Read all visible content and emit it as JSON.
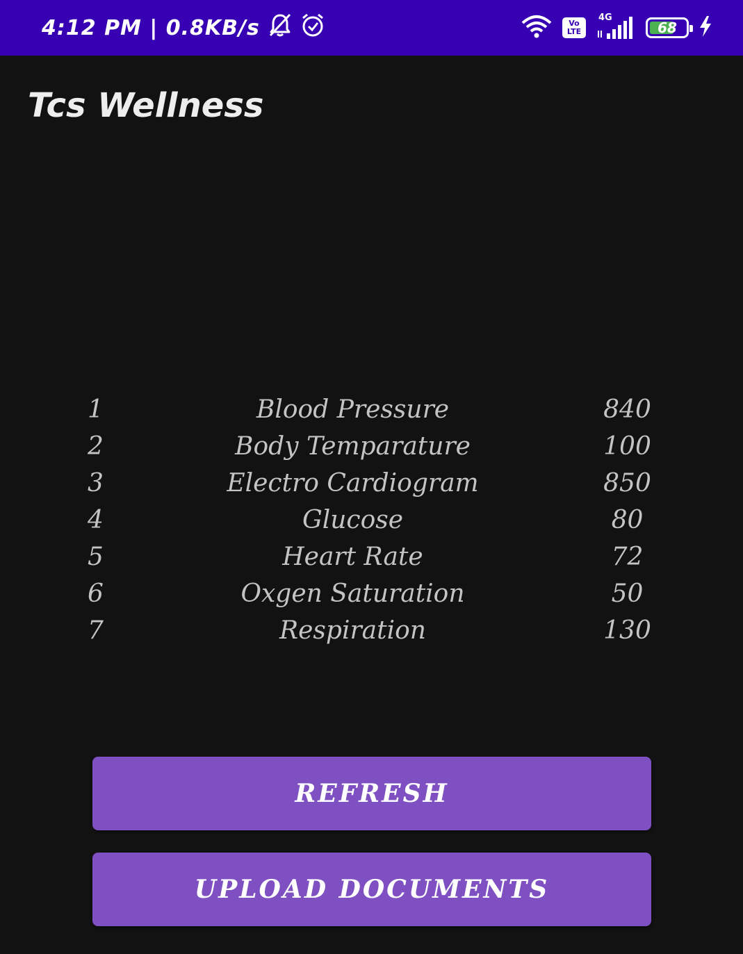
{
  "status_bar": {
    "time_speed": "4:12 PM | 0.8KB/s",
    "network_type": "4G",
    "volte_top": "Vo",
    "volte_bottom": "LTE",
    "battery_level": "68",
    "battery_fraction": 0.68,
    "icons": [
      "bell-off-icon",
      "alarm-icon",
      "wifi-icon",
      "volte-icon",
      "signal-icon",
      "battery-icon",
      "charging-icon"
    ],
    "bar_color": "#3700b3"
  },
  "app": {
    "title": "Tcs Wellness"
  },
  "vitals": [
    {
      "index": "1",
      "name": "Blood Pressure",
      "value": "840"
    },
    {
      "index": "2",
      "name": "Body Temparature",
      "value": "100"
    },
    {
      "index": "3",
      "name": "Electro Cardiogram",
      "value": "850"
    },
    {
      "index": "4",
      "name": "Glucose",
      "value": "80"
    },
    {
      "index": "5",
      "name": "Heart Rate",
      "value": "72"
    },
    {
      "index": "6",
      "name": "Oxgen Saturation",
      "value": "50"
    },
    {
      "index": "7",
      "name": "Respiration",
      "value": "130"
    }
  ],
  "buttons": {
    "refresh_label": "REFRESH",
    "upload_label": "UPLOAD DOCUMENTS",
    "color": "#7e50c1"
  },
  "colors": {
    "background": "#121212",
    "text": "#c4c4c4",
    "battery_fill": "#4caf50"
  }
}
